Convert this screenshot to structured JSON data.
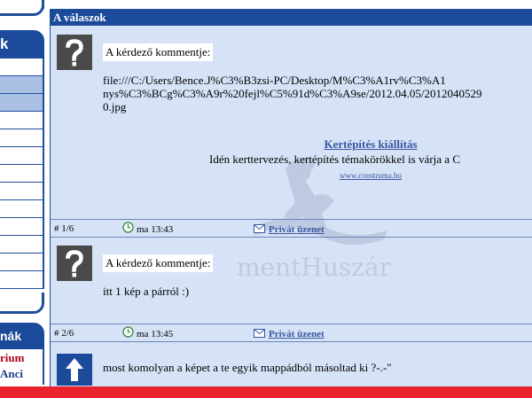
{
  "sidebar": {
    "box1_header": "k",
    "box2_header": "nák",
    "links": [
      {
        "label": "rium",
        "color": "red"
      },
      {
        "label": "Anci",
        "color": "blue"
      }
    ]
  },
  "panel": {
    "title": "A válaszok"
  },
  "posts": [
    {
      "avatar": "question-mark",
      "label": "A kérdező kommentje:",
      "text": "file:///C:/Users/Bence.J%C3%B3zsi-PC/Desktop/M%C3%A1rv%C3%A1\nnys%C3%BCg%C3%A9r%20fejl%C5%91d%C3%A9se/2012.04.05/2012040529\n0.jpg",
      "ad": {
        "title": "Kertépítés kiállítás",
        "desc": "Idén kerttervezés, kertépítés témakörökkel is várja a C",
        "url": "www.construma.hu"
      },
      "footer": {
        "number": "# 1/6",
        "time": "ma 13:43",
        "private": "Privát üzenet"
      }
    },
    {
      "avatar": "question-mark",
      "label": "A kérdező kommentje:",
      "text": "itt 1 kép a párról :)",
      "footer": {
        "number": "# 2/6",
        "time": "ma 13:45",
        "private": "Privát üzenet"
      }
    },
    {
      "avatar": "up-arrow",
      "text": "most komolyan a képet a te egyik mappádból másoltad ki ?-.-\""
    }
  ],
  "watermark": "mentHuszár",
  "colors": {
    "header_blue": "#1a4a99",
    "panel_bg": "#d6e3f7",
    "link_blue": "#3a55a0",
    "accent_red": "#e8232d"
  }
}
